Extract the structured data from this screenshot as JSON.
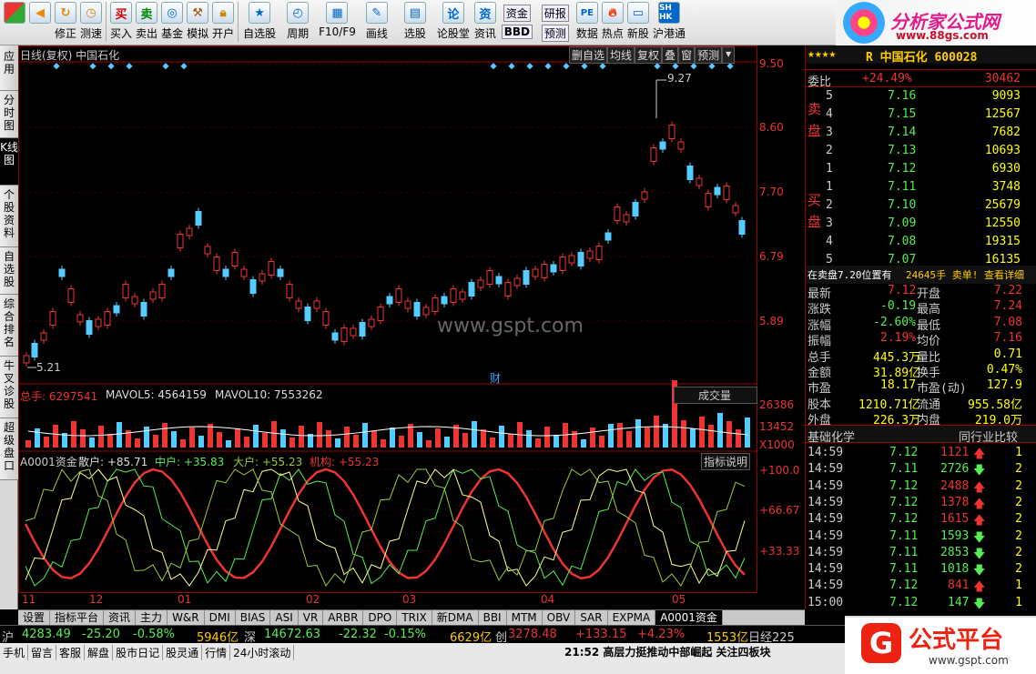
{
  "toolbar": {
    "items": [
      "修正",
      "测速",
      "买入",
      "卖出",
      "基金",
      "模拟",
      "开户",
      "自选股",
      "周期",
      "F10/F9",
      "画线",
      "选股",
      "论股堂",
      "资讯",
      "资金",
      "BBD",
      "研报",
      "预测",
      "数据",
      "热点",
      "新股",
      "沪港通"
    ]
  },
  "logo": {
    "title": "分析家公式网",
    "url": "www.88gs.com"
  },
  "left_tabs": [
    "应用",
    "分时图",
    "K线图",
    "个股资料",
    "自选股",
    "综合排名",
    "牛叉诊股",
    "超级盘口"
  ],
  "chart_header": {
    "title": "日线(复权) 中国石化",
    "buttons": [
      "删自选",
      "均线",
      "复权",
      "叠",
      "窗",
      "预测"
    ]
  },
  "watermark": "www.gspt.com",
  "price_axis": [
    "9.50",
    "8.60",
    "7.70",
    "6.79",
    "5.89"
  ],
  "annotations": {
    "high": "9.27",
    "low": "5.21",
    "cai": "财"
  },
  "volume_header": {
    "total": "总手: 6297541",
    "mavol5": "MAVOL5: 4564159",
    "mavol10": "MAVOL10: 7553262",
    "selector": "成交量"
  },
  "volume_axis": [
    "26386",
    "13452",
    "X1000"
  ],
  "indicator_header": {
    "name": "A0001资金",
    "retail": "散户: +85.71",
    "medium": "中户: +35.83",
    "large": "大户: +55.23",
    "inst": "机构: +55.23",
    "help": "指标说明"
  },
  "indicator_axis": [
    "+100.0",
    "+66.67",
    "+33.33"
  ],
  "x_labels": [
    "11",
    "12",
    "01",
    "02",
    "03",
    "04",
    "05"
  ],
  "bottom_tabs": [
    "设置",
    "指标平台",
    "资讯",
    "主力",
    "W&R",
    "DMI",
    "BIAS",
    "ASI",
    "VR",
    "ARBR",
    "DPO",
    "TRIX",
    "新DMA",
    "BBI",
    "MTM",
    "OBV",
    "SAR",
    "EXPMA",
    "A0001资金"
  ],
  "quote": {
    "stars": "★★★★",
    "name": "R 中国石化 600028",
    "wei_label": "委比",
    "wei_pct": "+24.49%",
    "wei_val": "30462",
    "sell_label": "卖盘",
    "buy_label": "买盘",
    "sell": [
      {
        "l": "5",
        "p": "7.16",
        "v": "9093"
      },
      {
        "l": "4",
        "p": "7.15",
        "v": "12567"
      },
      {
        "l": "3",
        "p": "7.14",
        "v": "7682"
      },
      {
        "l": "2",
        "p": "7.13",
        "v": "10693"
      },
      {
        "l": "1",
        "p": "7.12",
        "v": "6930"
      }
    ],
    "buy": [
      {
        "l": "1",
        "p": "7.11",
        "v": "3748"
      },
      {
        "l": "2",
        "p": "7.10",
        "v": "25679"
      },
      {
        "l": "3",
        "p": "7.09",
        "v": "12550"
      },
      {
        "l": "4",
        "p": "7.08",
        "v": "19315"
      },
      {
        "l": "5",
        "p": "7.07",
        "v": "16135"
      }
    ],
    "notice": "在卖盘7.20位置有",
    "notice2": "24645手 卖单! 查看详细",
    "stats": [
      {
        "k1": "最新",
        "v1": "7.12",
        "k2": "开盘",
        "v2": "7.22"
      },
      {
        "k1": "涨跌",
        "v1": "-0.19",
        "k2": "最高",
        "v2": "7.24"
      },
      {
        "k1": "涨幅",
        "v1": "-2.60%",
        "k2": "最低",
        "v2": "7.08"
      },
      {
        "k1": "振幅",
        "v1": "2.19%",
        "k2": "均价",
        "v2": "7.16"
      },
      {
        "k1": "总手",
        "v1": "445.3万",
        "k2": "量比",
        "v2": "0.71"
      },
      {
        "k1": "金额",
        "v1": "31.89亿",
        "k2": "换手",
        "v2": "0.47%"
      },
      {
        "k1": "市盈",
        "v1": "18.17",
        "k2": "市盈(动)",
        "v2": "127.9"
      },
      {
        "k1": "股本",
        "v1": "1210.71亿",
        "k2": "流通",
        "v2": "955.58亿"
      },
      {
        "k1": "外盘",
        "v1": "226.3万",
        "k2": "内盘",
        "v2": "219.0万"
      }
    ],
    "tabs": [
      "基础化学",
      "同行业比较"
    ],
    "ticks": [
      {
        "t": "14:59",
        "p": "7.12",
        "v": "1121",
        "d": "up",
        "n": "1"
      },
      {
        "t": "14:59",
        "p": "7.11",
        "v": "2726",
        "d": "down",
        "n": "2"
      },
      {
        "t": "14:59",
        "p": "7.12",
        "v": "2488",
        "d": "up",
        "n": "2"
      },
      {
        "t": "14:59",
        "p": "7.12",
        "v": "1378",
        "d": "up",
        "n": "2"
      },
      {
        "t": "14:59",
        "p": "7.12",
        "v": "1615",
        "d": "up",
        "n": "2"
      },
      {
        "t": "14:59",
        "p": "7.11",
        "v": "1593",
        "d": "down",
        "n": "2"
      },
      {
        "t": "14:59",
        "p": "7.11",
        "v": "2853",
        "d": "down",
        "n": "2"
      },
      {
        "t": "14:59",
        "p": "7.11",
        "v": "1018",
        "d": "down",
        "n": "2"
      },
      {
        "t": "14:59",
        "p": "7.12",
        "v": "841",
        "d": "up",
        "n": "1"
      },
      {
        "t": "15:00",
        "p": "7.12",
        "v": "147",
        "d": "down",
        "n": "1"
      }
    ]
  },
  "status": {
    "sh": "沪",
    "sh_idx": "4283.49",
    "sh_chg": "-25.20",
    "sh_pct": "-0.58%",
    "sh_amt": "5946亿",
    "sz": "深",
    "sz_idx": "14672.63",
    "sz_chg": "-22.32",
    "sz_pct": "-0.15%",
    "sz_amt": "6629亿",
    "cy": "创",
    "cy_idx": "3278.48",
    "cy_chg": "+133.15",
    "cy_pct": "+4.23%",
    "cy_amt": "1553亿",
    "rj": "日经225"
  },
  "status2": [
    "手机",
    "留言",
    "客服",
    "解盘",
    "股市日记",
    "股灵通",
    "行情",
    "24小时滚动"
  ],
  "news": "21:52 高层力挺推动中部崛起 关注四板块",
  "brand": {
    "name": "公式平台",
    "url": "www.gspt.com",
    "g": "G"
  },
  "chart_data": {
    "type": "candlestick",
    "ylim": [
      5.21,
      9.5
    ],
    "high": 9.27,
    "low": 5.21
  }
}
